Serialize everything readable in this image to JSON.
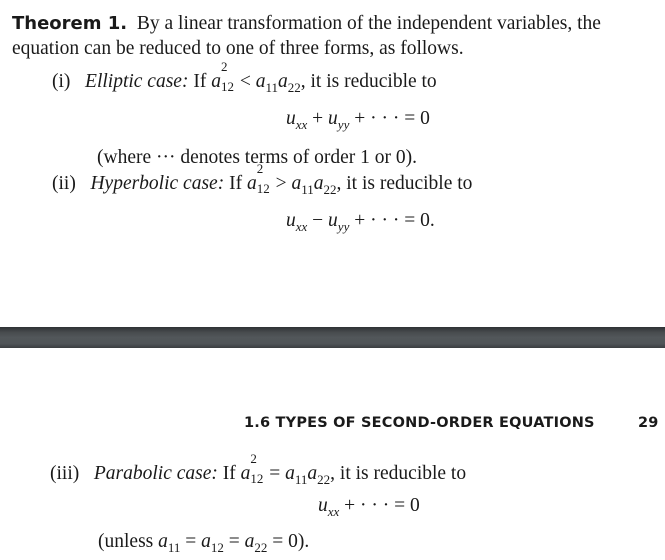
{
  "page_top": {
    "theorem_label": "Theorem 1.",
    "theorem_line1": "By a linear transformation of the independent variables, the",
    "theorem_line2": "equation can be reduced to one of three forms, as follows.",
    "case_i": {
      "num": "(i)",
      "name": "Elliptic case:",
      "cond_prefix": "If",
      "cond_rel": "<",
      "cond_suffix": ", it is reducible to",
      "equation": "u_xx + u_yy + ··· = 0",
      "note": "(where ··· denotes terms of order 1 or 0)."
    },
    "case_ii": {
      "num": "(ii)",
      "name": "Hyperbolic case:",
      "cond_prefix": "If",
      "cond_rel": ">",
      "cond_suffix": ", it is reducible to",
      "equation": "u_xx − u_yy + ··· = 0."
    }
  },
  "page_break": {
    "color_top": "#2e3134",
    "color_mid": "#52575a"
  },
  "page_bottom": {
    "running_head": "1.6   TYPES OF SECOND-ORDER EQUATIONS",
    "page_number": "29",
    "case_iii": {
      "num": "(iii)",
      "name": "Parabolic case:",
      "cond_prefix": "If",
      "cond_rel": "=",
      "cond_suffix": ", it is reducible to",
      "equation": "u_xx + ··· = 0",
      "note": "(unless a11 = a12 = a22 = 0)."
    }
  }
}
